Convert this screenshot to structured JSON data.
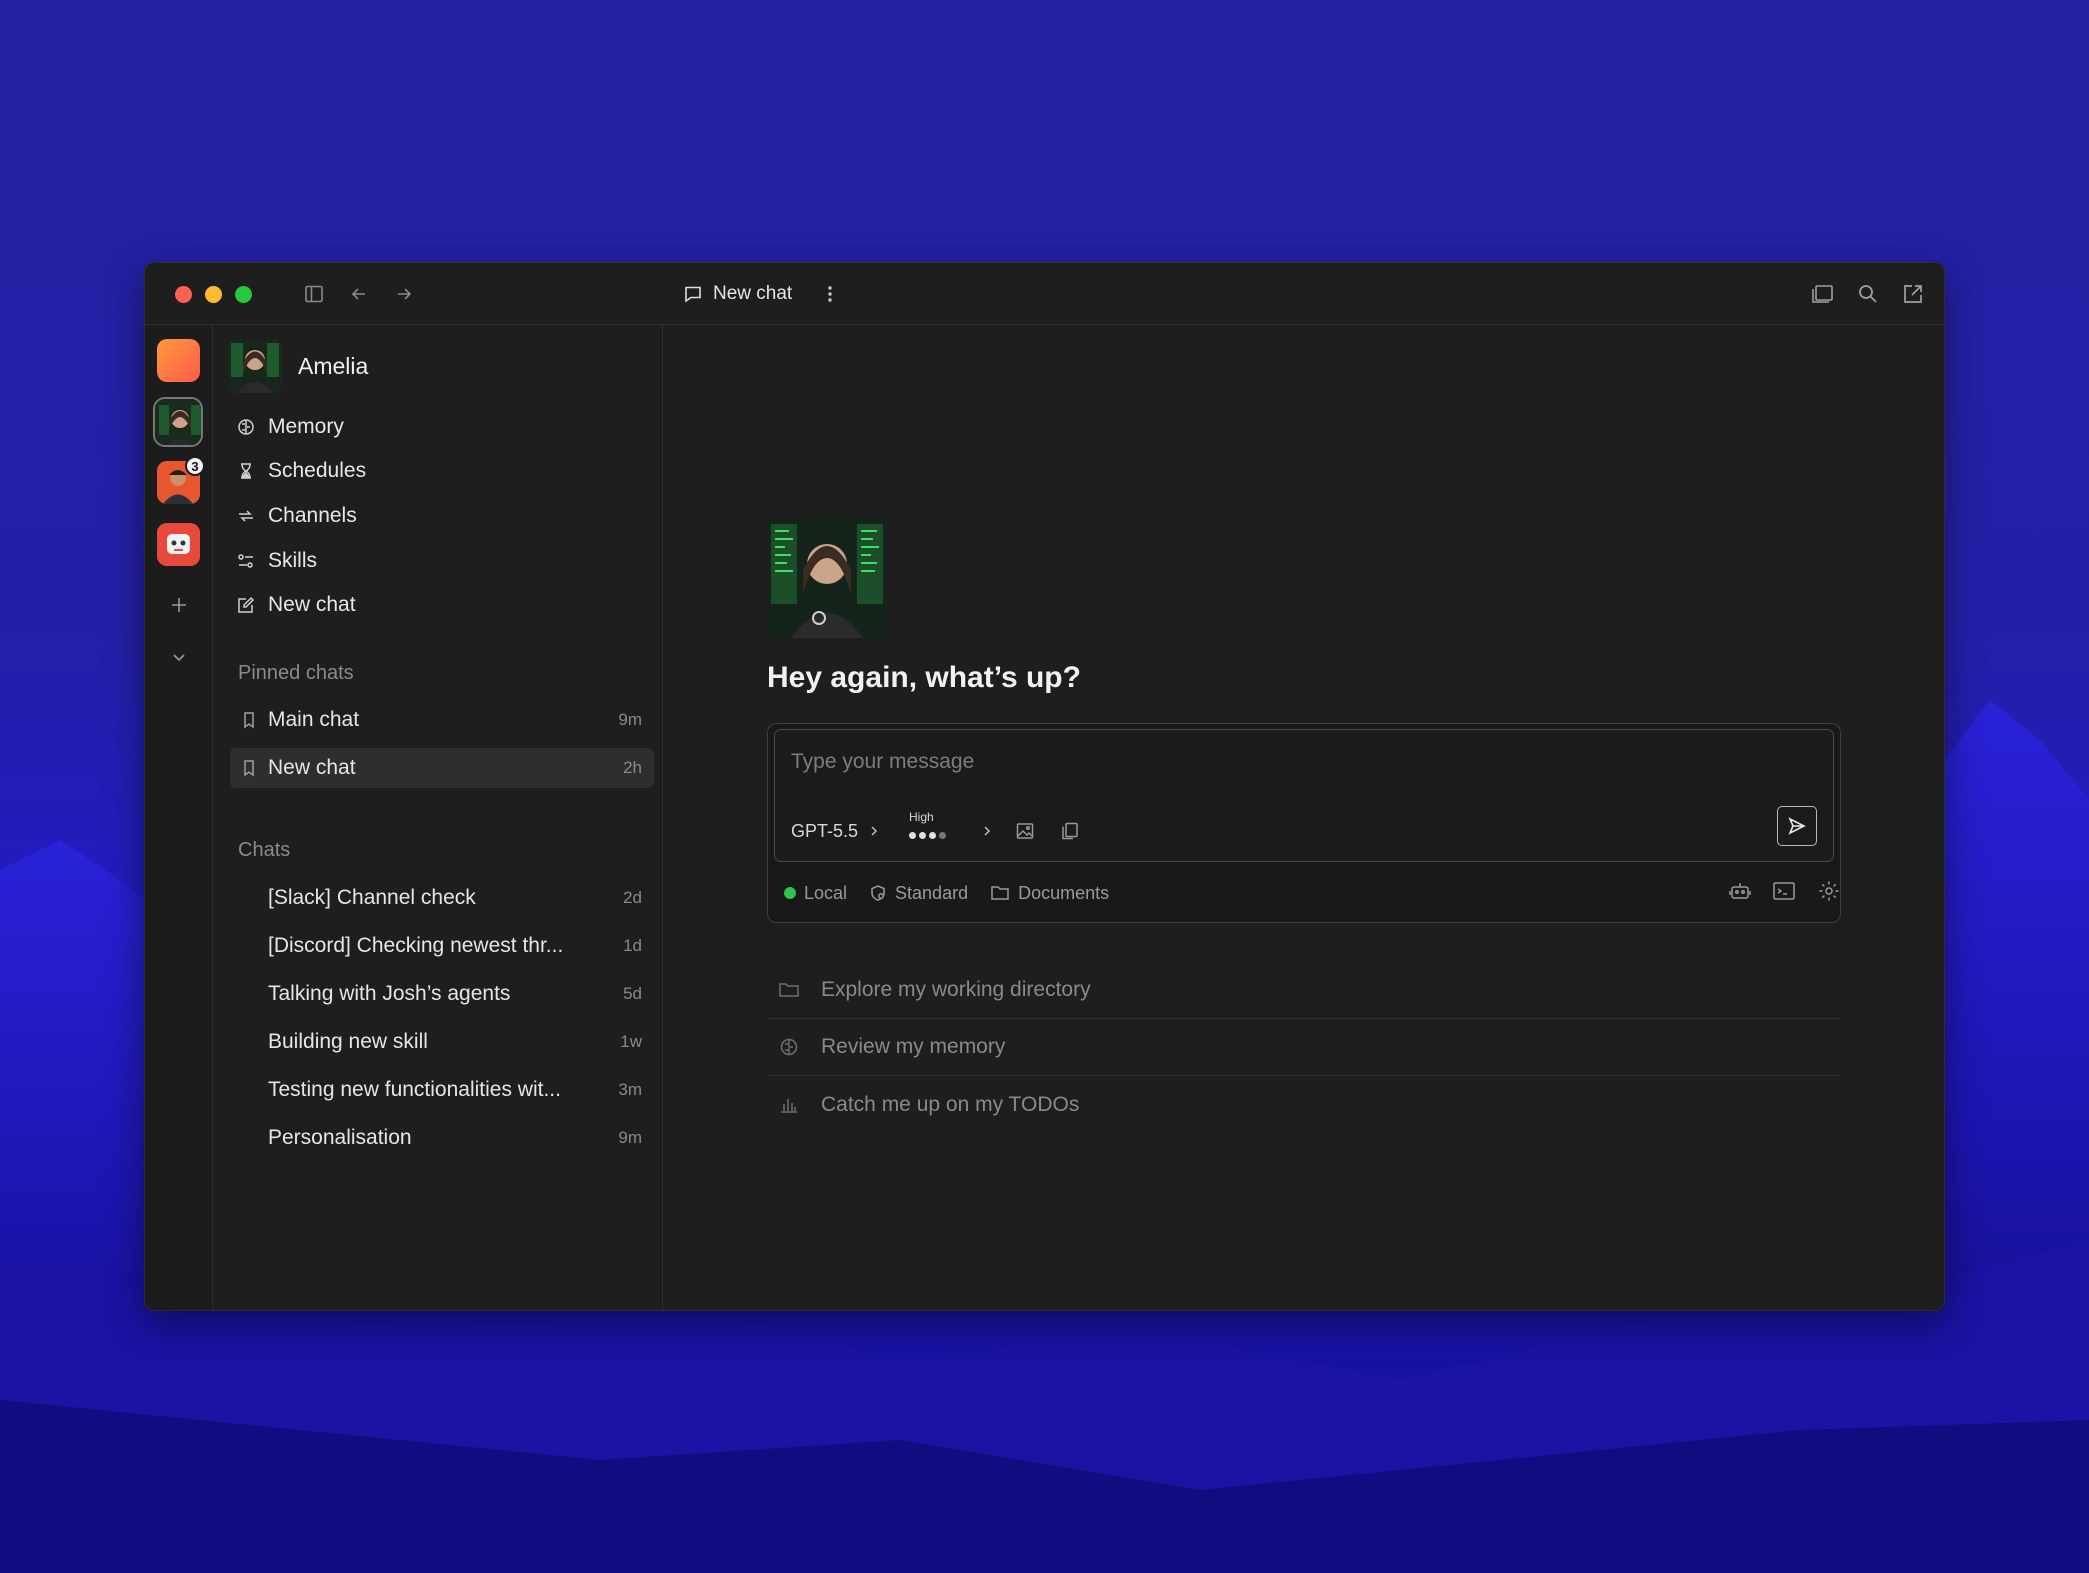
{
  "window": {
    "title": "New chat"
  },
  "agent": {
    "name": "Amelia"
  },
  "rail": {
    "badge_count": "3"
  },
  "nav": {
    "memory": "Memory",
    "schedules": "Schedules",
    "channels": "Channels",
    "skills": "Skills",
    "new_chat": "New chat"
  },
  "pinned": {
    "label": "Pinned chats",
    "items": [
      {
        "label": "Main chat",
        "time": "9m"
      },
      {
        "label": "New chat",
        "time": "2h"
      }
    ]
  },
  "chats": {
    "label": "Chats",
    "items": [
      {
        "label": "[Slack] Channel check",
        "time": "2d"
      },
      {
        "label": "[Discord] Checking newest thr...",
        "time": "1d"
      },
      {
        "label": "Talking with Josh’s agents",
        "time": "5d"
      },
      {
        "label": "Building new skill",
        "time": "1w"
      },
      {
        "label": "Testing new functionalities wit...",
        "time": "3m"
      },
      {
        "label": "Personalisation",
        "time": "9m"
      }
    ]
  },
  "main": {
    "greeting": "Hey again, what’s up?",
    "composer": {
      "placeholder": "Type your message",
      "model": "GPT-5.5",
      "effort_label": "High",
      "effort_level": 3,
      "effort_max": 4
    },
    "status": {
      "location": "Local",
      "mode": "Standard",
      "folder": "Documents"
    },
    "suggestions": [
      {
        "label": "Explore my working directory",
        "icon": "folder-icon"
      },
      {
        "label": "Review my memory",
        "icon": "brain-icon"
      },
      {
        "label": "Catch me up on my TODOs",
        "icon": "chart-icon"
      }
    ]
  },
  "colors": {
    "background": "#241fa6",
    "window": "#1d1d1d",
    "status_green": "#2fc24e"
  }
}
